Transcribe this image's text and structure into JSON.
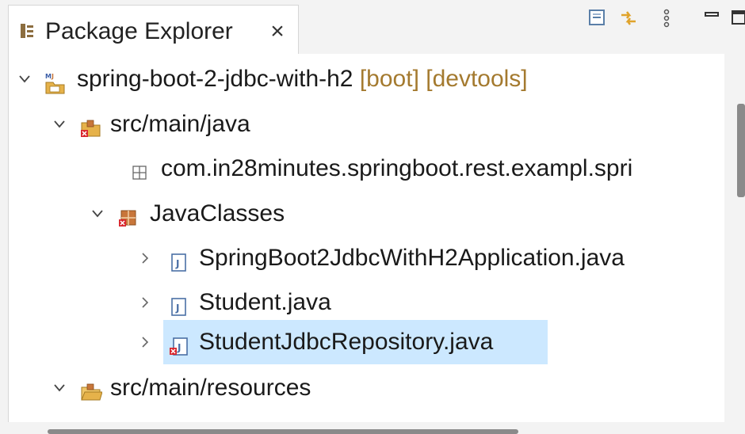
{
  "view": {
    "title": "Package Explorer",
    "close_glyph": "×",
    "icon": "package-explorer-icon",
    "toolbar": [
      {
        "name": "collapse-all-icon"
      },
      {
        "name": "link-with-editor-icon"
      },
      {
        "name": "view-menu-icon"
      },
      {
        "name": "minimize-icon"
      },
      {
        "name": "maximize-icon"
      }
    ]
  },
  "tree": {
    "project": {
      "label": "spring-boot-2-jdbc-with-h2",
      "decorations": "[boot] [devtools]",
      "expanded": true
    },
    "src_main_java": {
      "label": "src/main/java",
      "expanded": true
    },
    "package_default": {
      "label": "com.in28minutes.springboot.rest.exampl.spri"
    },
    "package_javaclasses": {
      "label": "JavaClasses",
      "expanded": true
    },
    "file_app": {
      "label": "SpringBoot2JdbcWithH2Application.java",
      "has_error": false
    },
    "file_student": {
      "label": "Student.java",
      "has_error": false
    },
    "file_repo": {
      "label": "StudentJdbcRepository.java",
      "has_error": true,
      "selected": true
    },
    "src_main_resources": {
      "label": "src/main/resources",
      "expanded": true
    }
  },
  "colors": {
    "selection": "#cce8ff",
    "decoration_text": "#a47a2f",
    "error_marker": "#d9272e",
    "package_icon": "#c8763a"
  }
}
